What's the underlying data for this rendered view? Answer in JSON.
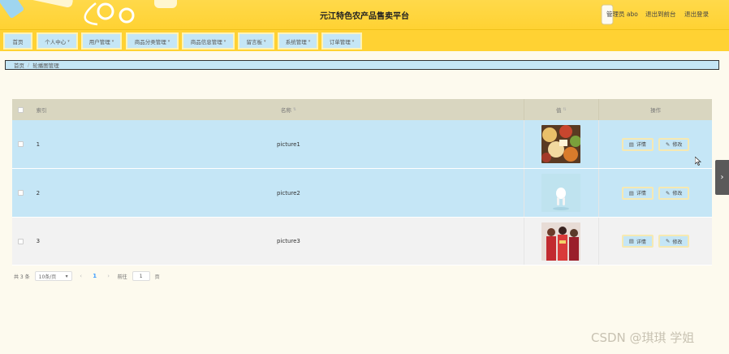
{
  "header": {
    "title": "元江特色农产品售卖平台",
    "user": "管理员 abo",
    "back_to_front": "退出到前台",
    "logout": "退出登录"
  },
  "nav": {
    "items": [
      {
        "label": "首页",
        "has_dropdown": false
      },
      {
        "label": "个人中心",
        "has_dropdown": true
      },
      {
        "label": "用户管理",
        "has_dropdown": true
      },
      {
        "label": "商品分类管理",
        "has_dropdown": true
      },
      {
        "label": "商品信息管理",
        "has_dropdown": true
      },
      {
        "label": "留言板",
        "has_dropdown": true
      },
      {
        "label": "系统管理",
        "has_dropdown": true
      },
      {
        "label": "订单管理",
        "has_dropdown": true
      }
    ]
  },
  "breadcrumb": {
    "home": "首页",
    "current": "轮播图管理"
  },
  "table": {
    "headers": {
      "index": "索引",
      "name": "名称",
      "image": "值",
      "actions": "操作"
    },
    "rows": [
      {
        "index": "1",
        "name": "picture1",
        "image_icon": "food-platter-photo",
        "detail": "详情",
        "edit": "修改"
      },
      {
        "index": "2",
        "name": "picture2",
        "image_icon": "earbuds-photo",
        "detail": "详情",
        "edit": "修改"
      },
      {
        "index": "3",
        "name": "picture3",
        "image_icon": "people-photo",
        "detail": "详情",
        "edit": "修改"
      }
    ]
  },
  "pagination": {
    "total": "共 3 条",
    "page_size": "10条/页",
    "current_page": "1",
    "goto_label": "前往",
    "goto_value": "1",
    "page_unit": "页"
  },
  "watermark": "CSDN @琪琪 学姐",
  "colors": {
    "header": "#ffd233",
    "nav_button": "#c5e6f6",
    "row_blue": "#c5e6f6",
    "row_gray": "#f2f2f2",
    "table_head": "#d9d6c0",
    "page_active": "#409eff"
  }
}
